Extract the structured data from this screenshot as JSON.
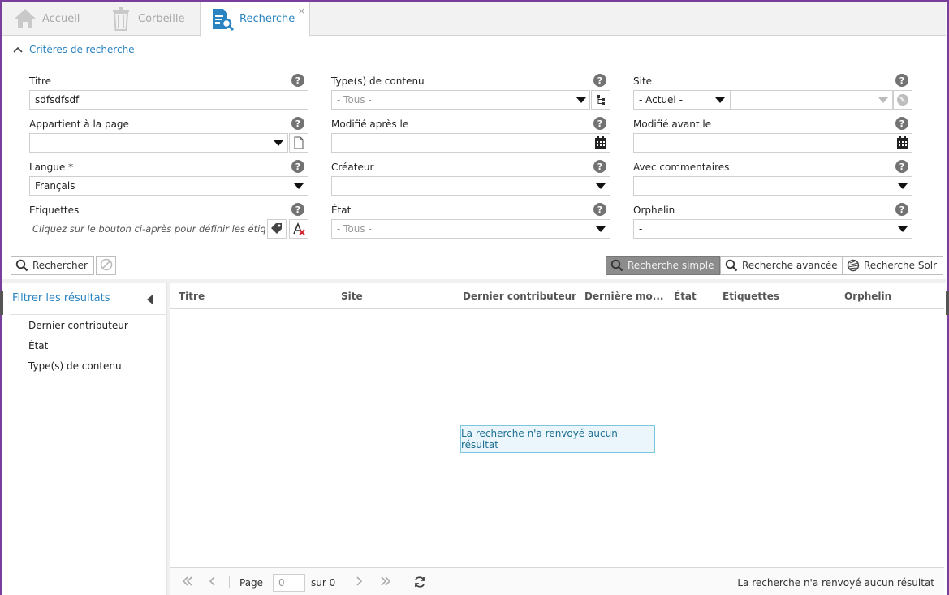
{
  "tabs": [
    {
      "label": "Accueil",
      "icon": "home-icon"
    },
    {
      "label": "Corbeille",
      "icon": "trash-icon"
    },
    {
      "label": "Recherche",
      "icon": "search-document-icon",
      "close": "×"
    }
  ],
  "criteria": {
    "toggle_label": "Critères de recherche",
    "help_glyph": "?",
    "fields": {
      "titre": {
        "label": "Titre",
        "value": "sdfsdfsdf"
      },
      "types": {
        "label": "Type(s) de contenu",
        "value": "- Tous -"
      },
      "site": {
        "label": "Site",
        "value": "- Actuel -"
      },
      "page": {
        "label": "Appartient à la page",
        "value": ""
      },
      "modif_apres": {
        "label": "Modifié après le",
        "value": ""
      },
      "modif_avant": {
        "label": "Modifié avant le",
        "value": ""
      },
      "langue": {
        "label": "Langue *",
        "value": "Français"
      },
      "createur": {
        "label": "Créateur",
        "value": ""
      },
      "commentaires": {
        "label": "Avec commentaires",
        "value": ""
      },
      "etiquettes": {
        "label": "Etiquettes",
        "value": "Cliquez sur le bouton ci-après pour définir les étiqu..."
      },
      "etat": {
        "label": "État",
        "value": "- Tous -"
      },
      "orphelin": {
        "label": "Orphelin",
        "value": "-"
      }
    }
  },
  "actions": {
    "search": "Rechercher",
    "simple": "Recherche simple",
    "advanced": "Recherche avancée",
    "solr": "Recherche Solr"
  },
  "filters": {
    "title": "Filtrer les résultats",
    "items": [
      "Dernier contributeur",
      "État",
      "Type(s) de contenu"
    ]
  },
  "grid": {
    "columns": [
      "Titre",
      "Site",
      "Dernier contributeur",
      "Dernière mo...",
      "État",
      "Etiquettes",
      "Orphelin"
    ],
    "empty_message": "La recherche n'a renvoyé aucun résultat"
  },
  "pager": {
    "page_label": "Page",
    "page_value": "0",
    "of_label": "sur 0",
    "status": "La recherche n'a renvoyé aucun résultat"
  },
  "colors": {
    "accent": "#2a84c1",
    "frame": "#7a3f9d",
    "pressed": "#8c8c8c"
  }
}
